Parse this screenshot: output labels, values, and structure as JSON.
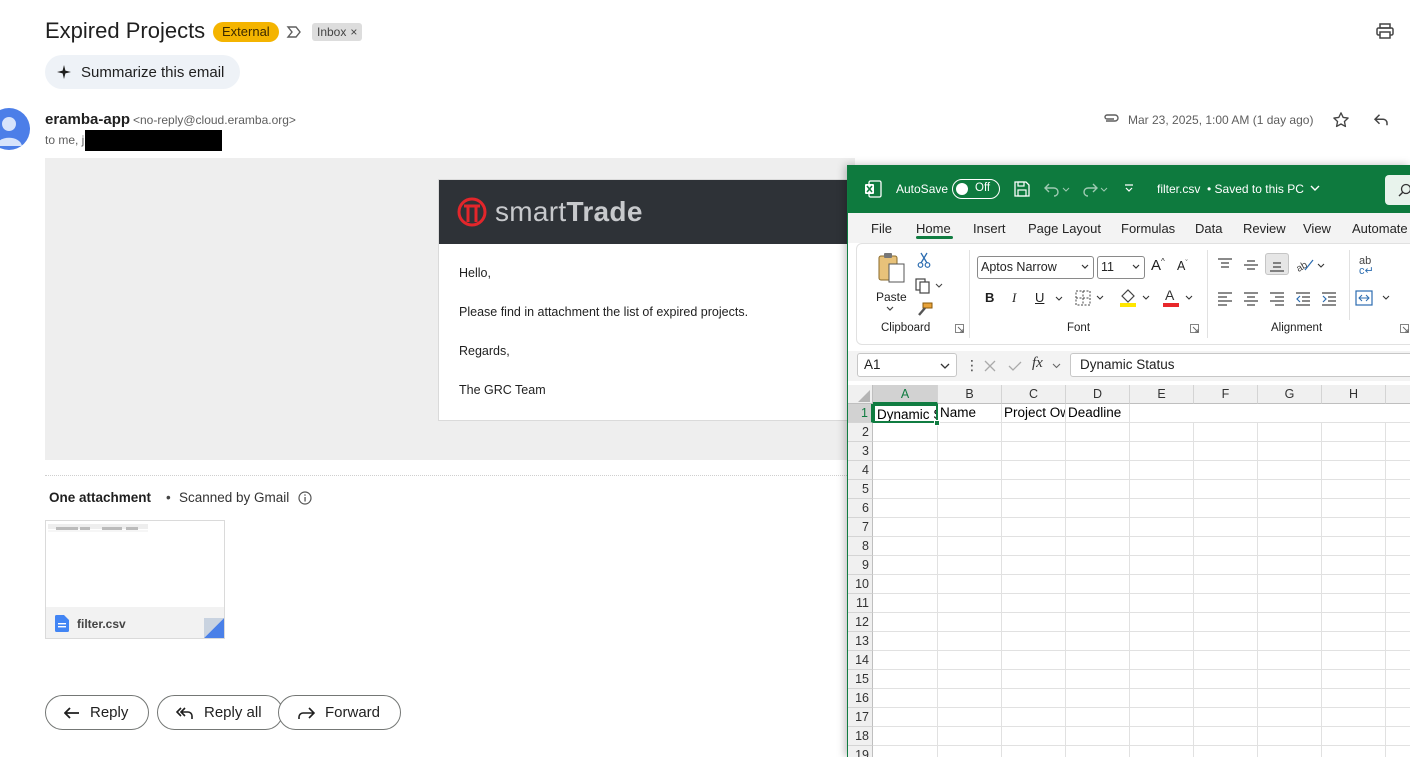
{
  "email": {
    "subject": "Expired Projects",
    "labels": {
      "external": "External",
      "inbox": "Inbox",
      "remove": "×"
    },
    "summarize_label": "Summarize this email",
    "sender_name": "eramba-app",
    "sender_email": "<no-reply@cloud.eramba.org>",
    "to_line": "to me, j",
    "date": "Mar 23, 2025, 1:00 AM (1 day ago)",
    "body": {
      "logo_prefix": "smart",
      "logo_suffix": "Trade",
      "lines": [
        "Hello,",
        "Please find in attachment the list of expired projects.",
        "Regards,",
        "The GRC Team"
      ]
    },
    "attachments": {
      "title": "One attachment",
      "separator": "•",
      "scan_note": "Scanned by Gmail",
      "file_name": "filter.csv"
    },
    "actions": {
      "reply": "Reply",
      "reply_all": "Reply all",
      "forward": "Forward"
    }
  },
  "excel": {
    "autosave_label": "AutoSave",
    "autosave_state": "Off",
    "file_title": "filter.csv",
    "file_status": "• Saved to this PC",
    "tabs": [
      "File",
      "Home",
      "Insert",
      "Page Layout",
      "Formulas",
      "Data",
      "Review",
      "View",
      "Automate"
    ],
    "active_tab": "Home",
    "ribbon": {
      "paste_label": "Paste",
      "clipboard_label": "Clipboard",
      "font_label": "Font",
      "alignment_label": "Alignment",
      "font_name": "Aptos Narrow",
      "font_size": "11",
      "bold": "B",
      "italic": "I",
      "underline": "U",
      "grow": "A",
      "shrink": "A",
      "font_color": "A",
      "wrap": "ab"
    },
    "name_box": "A1",
    "fx": "fx",
    "formula": "Dynamic Status",
    "columns": [
      "A",
      "B",
      "C",
      "D",
      "E",
      "F",
      "G",
      "H"
    ],
    "rows": [
      "1",
      "2",
      "3",
      "4",
      "5",
      "6",
      "7",
      "8",
      "9",
      "10",
      "11",
      "12",
      "13",
      "14",
      "15",
      "16",
      "17",
      "18",
      "19"
    ],
    "row1": [
      "Dynamic Status",
      "Name",
      "Project Owner",
      "Deadline"
    ]
  },
  "colors": {
    "excel_green": "#107c41",
    "badge_external": "#f4b400",
    "smarttrade_red": "#e3262b"
  }
}
